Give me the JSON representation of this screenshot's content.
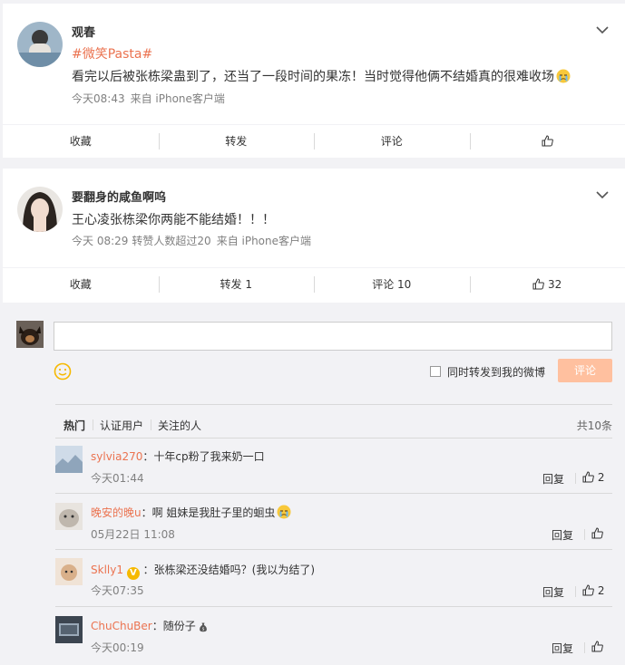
{
  "posts": [
    {
      "author": "观春",
      "topic": "#微笑Pasta#",
      "text": "看完以后被张栋梁蛊到了，还当了一段时间的果冻！当时觉得他俩不结婚真的很难收场",
      "time": "今天08:43",
      "source": "来自 iPhone客户端",
      "actions": {
        "favorite": "收藏",
        "forward": "转发",
        "comment": "评论",
        "like": ""
      }
    },
    {
      "author": "要翻身的咸鱼啊呜",
      "text": "王心凌张栋梁你两能不能结婚！！！",
      "time": "今天 08:29",
      "forward_note": "转赞人数超过20",
      "source": "来自 iPhone客户端",
      "actions": {
        "favorite": "收藏",
        "forward": "转发 1",
        "comment": "评论 10",
        "like": "32"
      }
    }
  ],
  "composer": {
    "input_value": "",
    "forward_label": "同时转发到我的微博",
    "submit_label": "评论"
  },
  "comment_filters": [
    "热门",
    "认证用户",
    "关注的人"
  ],
  "comment_total": "共10条",
  "comments": [
    {
      "user": "sylvia270",
      "text": "：十年cp粉了我来奶一口",
      "time": "今天01:44",
      "reply": "回复",
      "likes": "2"
    },
    {
      "user": "晚安的晚u",
      "text": "：啊 姐妹是我肚子里的蛔虫",
      "time": "05月22日 11:08",
      "reply": "回复",
      "likes": ""
    },
    {
      "user": "Sklly1",
      "text": "：张栋梁还没结婚吗？(我以为结了)",
      "time": "今天07:35",
      "reply": "回复",
      "likes": "2"
    },
    {
      "user": "ChuChuBer",
      "text": "：随份子",
      "time": "今天00:19",
      "reply": "回复",
      "likes": ""
    }
  ],
  "colors": {
    "accent": "#eb7350",
    "submit_disabled": "#ffc09f",
    "background": "#f2f2f5",
    "verified": "#f6b900"
  }
}
